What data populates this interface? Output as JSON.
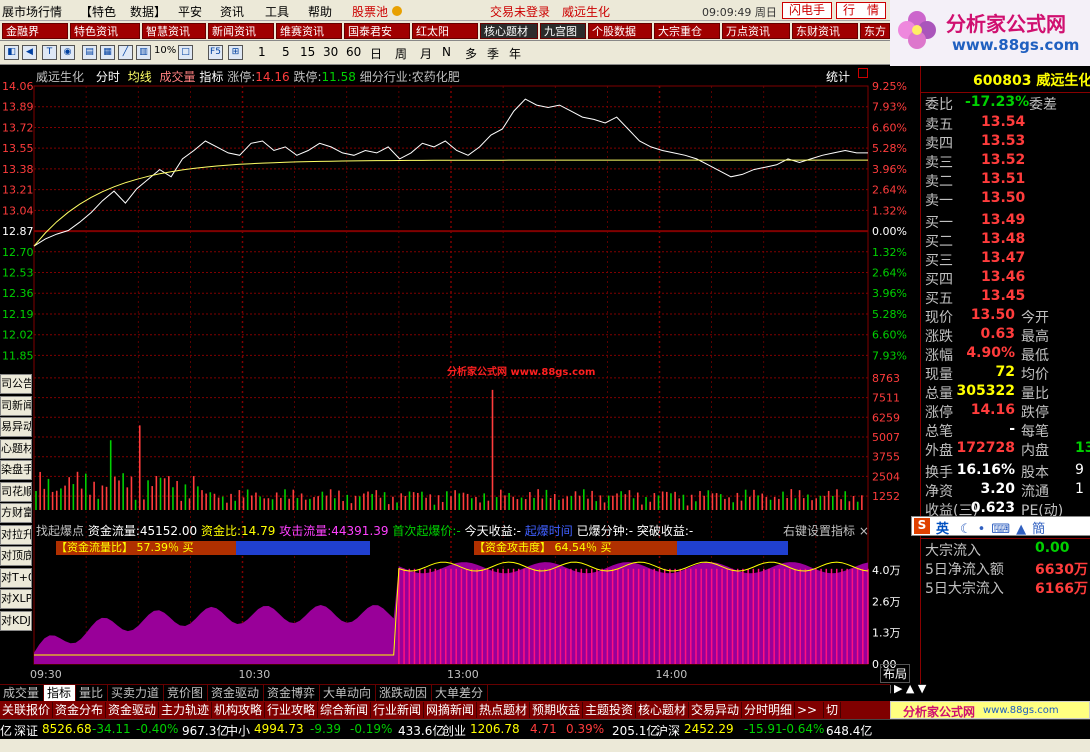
{
  "menubar": {
    "items": [
      "展市场行情",
      "【特色",
      "数据】",
      "平安",
      "资讯",
      "工具",
      "帮助"
    ],
    "stock_pool": "股票池",
    "login": "交易未登录",
    "stock_name": "威远生化",
    "time": "09:09:49",
    "weekday": "周日",
    "flash": "闪电手",
    "market": "行　情"
  },
  "logo": {
    "brand": "分析家公式网",
    "url": "www.88gs.com"
  },
  "infobar": {
    "tabs": [
      "金融界",
      "特色资讯",
      "智慧资讯",
      "新闻资讯",
      "维赛资讯",
      "国泰君安",
      "红太阳",
      "核心题材",
      "九宫图",
      "个股数据",
      "大宗重仓",
      "万点资讯",
      "东财资讯",
      "东方"
    ]
  },
  "toolbar": {
    "periods": [
      "1",
      "5",
      "15",
      "30",
      "60",
      "日",
      "周",
      "月",
      "N",
      "多",
      "季",
      "年"
    ],
    "pct": "10%",
    "f5": "F5"
  },
  "chart": {
    "header": {
      "name": "威远生化",
      "mode": "分时",
      "avg": "均线",
      "vol": "成交量",
      "indicator": "指标",
      "limit_up_label": "涨停:",
      "limit_up": "14.16",
      "limit_down_label": "跌停:",
      "limit_down": "11.58",
      "industry": "细分行业:农药化肥",
      "stats": "统计"
    },
    "price_left": [
      "14.06",
      "13.89",
      "13.72",
      "13.55",
      "13.38",
      "13.21",
      "13.04",
      "12.87",
      "12.70",
      "12.53",
      "12.36",
      "12.19",
      "12.02",
      "11.85"
    ],
    "pct_right": [
      "9.25%",
      "7.93%",
      "6.60%",
      "5.28%",
      "3.96%",
      "2.64%",
      "1.32%",
      "0.00%",
      "1.32%",
      "2.64%",
      "3.96%",
      "5.28%",
      "6.60%",
      "7.93%"
    ],
    "vol_right": [
      "8763",
      "7511",
      "6259",
      "5007",
      "3755",
      "2504",
      "1252"
    ],
    "watermark": "分析家公式网 www.88gs.com",
    "indicator_bar": {
      "a": "找起爆点",
      "b": "资金流量:",
      "b_val": "45152.00",
      "c": "资金比:",
      "c_val": "14.79",
      "d": "攻击流量:",
      "d_val": "44391.39",
      "e": "首次起爆价:",
      "e_val": "-",
      "f": "今天收益:",
      "f_val": "-",
      "g": "起爆时间",
      "h": "已爆分钟:",
      "h_val": "-",
      "i": "突破收益:",
      "i_val": "-",
      "set": "右键设置指标"
    },
    "gauge1": {
      "label": "【资金流量比】",
      "text": "57.39％ 买",
      "fill": 0.5739
    },
    "gauge2": {
      "label": "【资金攻击度】",
      "text": "64.54％ 买",
      "fill": 0.6454
    },
    "ind_right": [
      "4.0万",
      "2.6万",
      "1.3万",
      "0.00"
    ],
    "times": [
      "09:30",
      "10:30",
      "13:00",
      "14:00"
    ],
    "layout_btn": "布局"
  },
  "side_buttons": [
    "司公告",
    "司新闻",
    "易异动",
    "心题材",
    "染盘手",
    "司花顺",
    "方财富",
    "对拉升",
    "对顶底",
    "对T+0",
    "对XLPL",
    "对KDJ"
  ],
  "quote": {
    "code": "600803",
    "name": "威远生化",
    "weibi_label": "委比",
    "weibi": "-17.23%",
    "weicha": "委差",
    "asks": [
      [
        "卖五",
        "13.54"
      ],
      [
        "卖四",
        "13.53"
      ],
      [
        "卖三",
        "13.52"
      ],
      [
        "卖二",
        "13.51"
      ],
      [
        "卖一",
        "13.50"
      ]
    ],
    "bids": [
      [
        "买一",
        "13.49"
      ],
      [
        "买二",
        "13.48"
      ],
      [
        "买三",
        "13.47"
      ],
      [
        "买四",
        "13.46"
      ],
      [
        "买五",
        "13.45"
      ]
    ],
    "stats": [
      [
        "现价",
        "13.50",
        "今开",
        ""
      ],
      [
        "涨跌",
        "0.63",
        "最高",
        ""
      ],
      [
        "涨幅",
        "4.90%",
        "最低",
        ""
      ],
      [
        "现量",
        "72",
        "均价",
        ""
      ],
      [
        "总量",
        "305322",
        "量比",
        ""
      ],
      [
        "涨停",
        "14.16",
        "跌停",
        ""
      ],
      [
        "总笔",
        "-",
        "每笔",
        ""
      ],
      [
        "外盘",
        "172728",
        "内盘",
        "13"
      ]
    ],
    "stats2": [
      [
        "换手",
        "16.16%",
        "股本",
        "9"
      ],
      [
        "净资",
        "3.20",
        "流通",
        "1"
      ],
      [
        "收益(三)",
        "0.623",
        "PE(动)",
        ""
      ]
    ],
    "ime": "英",
    "flows": [
      [
        "大宗流入",
        "0.00"
      ],
      [
        "5日净流入额",
        "6630万"
      ],
      [
        "5日大宗流入",
        "6166万"
      ]
    ]
  },
  "bottom_tabs": [
    "成交量",
    "指标",
    "量比",
    "买卖力道",
    "竞价图",
    "资金驱动",
    "资金博弈",
    "大单动向",
    "涨跌动因",
    "大单差分"
  ],
  "func_tabs": [
    "关联报价",
    "资金分布",
    "资金驱动",
    "主力轨迹",
    "机构攻略",
    "行业攻略",
    "综合新闻",
    "行业新闻",
    "网摘新闻",
    "热点题材",
    "预期收益",
    "主题投资",
    "核心题材",
    "交易异动",
    "分时明细",
    ">>",
    "切"
  ],
  "status": {
    "a": "亿",
    "b": "深证",
    "b_v": "8526.68",
    "b_c": "-34.11",
    "b_p": "-0.40%",
    "b_a": "967.3亿",
    "c": "中小",
    "c_v": "4994.73",
    "c_c": "-9.39",
    "c_p": "-0.19%",
    "c_a": "433.6亿",
    "d": "创业",
    "d_v": "1206.78",
    "d_c": "4.71",
    "d_p": "0.39%",
    "d_a": "205.1亿",
    "e": "沪深",
    "e_v": "2452.29",
    "e_c": "-15.91",
    "e_p": "-0.64%",
    "e_a": "648.4亿",
    "brand": "分析家公式网",
    "url": "www.88gs.com"
  },
  "colors": {
    "up": "#ff3c3c",
    "down": "#00d000",
    "price": "#ffffff",
    "avg": "#ffff66",
    "grid": "#800000",
    "purple": "#990099",
    "yellow": "#ffff00"
  }
}
